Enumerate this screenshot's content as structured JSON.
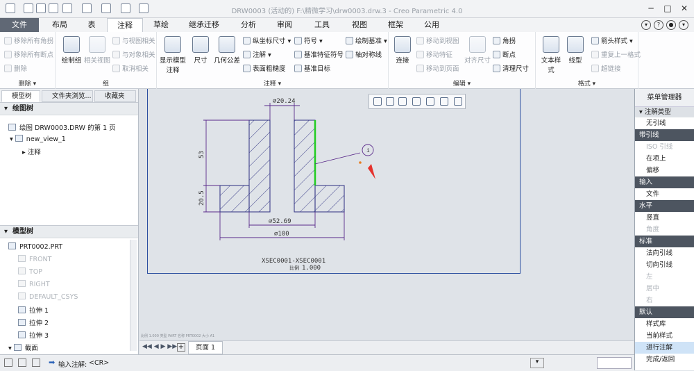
{
  "window": {
    "title": "DRW0003 (活动的) F:\\精微学习\\drw0003.drw.3 - Creo Parametric 4.0"
  },
  "tabs": [
    "文件",
    "布局",
    "表",
    "注释",
    "草绘",
    "继承迁移",
    "分析",
    "审阅",
    "工具",
    "视图",
    "框架",
    "公用"
  ],
  "active_tab": "注释",
  "ribbon": {
    "delete": {
      "items": [
        "移除所有角拐",
        "移除所有断点",
        "删除"
      ],
      "label": "删除"
    },
    "group": {
      "items": [
        "绘制组",
        "相关视图",
        "与视图相关",
        "与对象相关",
        "取消相关"
      ],
      "label": "组"
    },
    "annotation": {
      "show_model": "显示模型注释",
      "dimension": "尺寸",
      "gtol": "几何公差",
      "ordinate": "纵坐标尺寸",
      "note": "注解",
      "roughness": "表面粗糙度",
      "symbol": "符号",
      "datum_feature": "基准特征符号",
      "datum_target": "基准目标",
      "draw_datum": "绘制基准",
      "axis_sym": "轴对称线",
      "label": "注释"
    },
    "edit": {
      "connect": "连接",
      "move_view": "移动到视图",
      "move_feature": "移动特征",
      "move_page": "移动到页面",
      "align": "对齐尺寸",
      "corner": "角拐",
      "breakpoint": "断点",
      "clean": "清理尺寸",
      "label": "编辑"
    },
    "format": {
      "text_style": "文本样式",
      "line_style": "线型",
      "arrow_style": "箭头样式",
      "repeat_last": "重复上一格式",
      "hyperlink": "超链接",
      "label": "格式"
    }
  },
  "left_panel": {
    "tabs": [
      "模型树",
      "文件夹浏览...",
      "收藏夹"
    ],
    "drawing_tree": {
      "header": "绘图树",
      "items": [
        "绘图 DRW0003.DRW 的第 1 页",
        "new_view_1",
        "注释"
      ]
    },
    "model_tree": {
      "header": "模型树",
      "items": [
        "PRT0002.PRT",
        "FRONT",
        "TOP",
        "RIGHT",
        "DEFAULT_CSYS",
        "拉伸 1",
        "拉伸 2",
        "拉伸 3",
        "截面"
      ]
    }
  },
  "drawing": {
    "dims": {
      "top": "⌀20.24",
      "mid": "⌀52.69",
      "bottom": "⌀100",
      "h1": "53",
      "h2": "20.5"
    },
    "balloon": "i",
    "section_label": "XSEC0001-XSEC0001",
    "scale_label": "比例",
    "scale_value": "1.000",
    "sheet_tab": "页面 1",
    "tray_text": "比例 1.000   类型 PART   名称 PRT0002   大小 A1"
  },
  "menu_manager": {
    "title": "菜单管理器",
    "header": "注解类型",
    "items": [
      {
        "text": "无引线",
        "kind": "item"
      },
      {
        "text": "带引线",
        "kind": "hdr"
      },
      {
        "text": "ISO 引线",
        "kind": "dis"
      },
      {
        "text": "在项上",
        "kind": "item"
      },
      {
        "text": "偏移",
        "kind": "item"
      },
      {
        "text": "输入",
        "kind": "hdr"
      },
      {
        "text": "文件",
        "kind": "item"
      },
      {
        "text": "水平",
        "kind": "hdr"
      },
      {
        "text": "竖直",
        "kind": "item"
      },
      {
        "text": "角度",
        "kind": "dis"
      },
      {
        "text": "标准",
        "kind": "hdr"
      },
      {
        "text": "法向引线",
        "kind": "item"
      },
      {
        "text": "切向引线",
        "kind": "item"
      },
      {
        "text": "左",
        "kind": "dis"
      },
      {
        "text": "居中",
        "kind": "dis"
      },
      {
        "text": "右",
        "kind": "dis"
      },
      {
        "text": "默认",
        "kind": "hdr"
      },
      {
        "text": "样式库",
        "kind": "item"
      },
      {
        "text": "当前样式",
        "kind": "item"
      },
      {
        "text": "进行注解",
        "kind": "sel"
      },
      {
        "text": "完成/返回",
        "kind": "item"
      }
    ]
  },
  "status": {
    "prompt": "输入注解:",
    "value": "<CR>"
  }
}
